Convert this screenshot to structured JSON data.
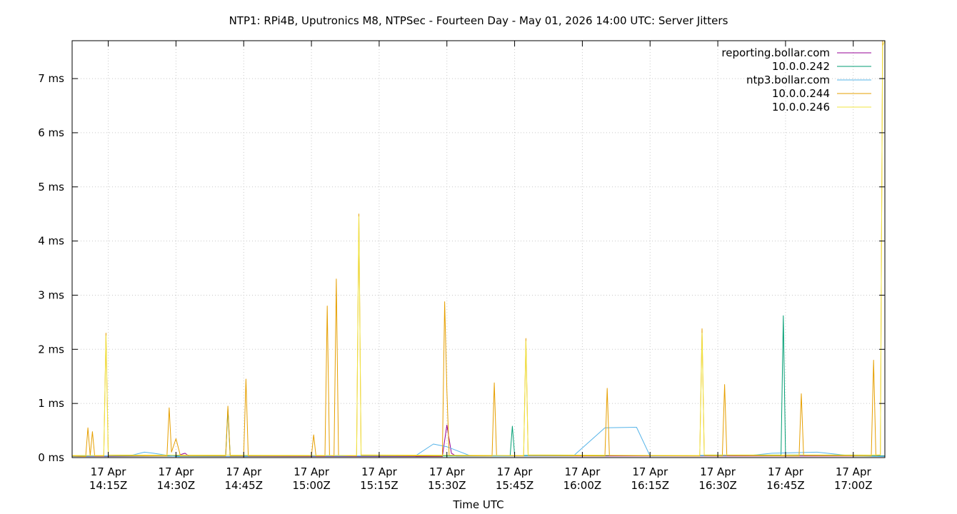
{
  "chart_data": {
    "type": "line",
    "title": "NTP1: RPi4B, Uputronics M8, NTPSec - Fourteen Day - May 01, 2026 14:00 UTC: Server Jitters",
    "xlabel": "Time UTC",
    "ylabel": "",
    "x_ticks": [
      {
        "value": "2026-04-17T14:15Z",
        "date": "17 Apr",
        "time": "14:15Z"
      },
      {
        "value": "2026-04-17T14:30Z",
        "date": "17 Apr",
        "time": "14:30Z"
      },
      {
        "value": "2026-04-17T14:45Z",
        "date": "17 Apr",
        "time": "14:45Z"
      },
      {
        "value": "2026-04-17T15:00Z",
        "date": "17 Apr",
        "time": "15:00Z"
      },
      {
        "value": "2026-04-17T15:15Z",
        "date": "17 Apr",
        "time": "15:15Z"
      },
      {
        "value": "2026-04-17T15:30Z",
        "date": "17 Apr",
        "time": "15:30Z"
      },
      {
        "value": "2026-04-17T15:45Z",
        "date": "17 Apr",
        "time": "15:45Z"
      },
      {
        "value": "2026-04-17T16:00Z",
        "date": "17 Apr",
        "time": "16:00Z"
      },
      {
        "value": "2026-04-17T16:15Z",
        "date": "17 Apr",
        "time": "16:15Z"
      },
      {
        "value": "2026-04-17T16:30Z",
        "date": "17 Apr",
        "time": "16:30Z"
      },
      {
        "value": "2026-04-17T16:45Z",
        "date": "17 Apr",
        "time": "16:45Z"
      },
      {
        "value": "2026-04-17T17:00Z",
        "date": "17 Apr",
        "time": "17:00Z"
      }
    ],
    "xlim": [
      "2026-04-17T14:07Z",
      "2026-04-17T17:07Z"
    ],
    "y_ticks": [
      {
        "value": 0,
        "label": "0 ms"
      },
      {
        "value": 1,
        "label": "1 ms"
      },
      {
        "value": 2,
        "label": "2 ms"
      },
      {
        "value": 3,
        "label": "3 ms"
      },
      {
        "value": 4,
        "label": "4 ms"
      },
      {
        "value": 5,
        "label": "5 ms"
      },
      {
        "value": 6,
        "label": "6 ms"
      },
      {
        "value": 7,
        "label": "7 ms"
      }
    ],
    "ylim": [
      0,
      7.7
    ],
    "grid": true,
    "legend_position": "top-right",
    "series": [
      {
        "name": "reporting.bollar.com",
        "color": "#940094",
        "points": [
          [
            "2026-04-17T14:07Z",
            0.02
          ],
          [
            "2026-04-17T14:30Z",
            0.03
          ],
          [
            "2026-04-17T14:32Z",
            0.08
          ],
          [
            "2026-04-17T14:33Z",
            0.02
          ],
          [
            "2026-04-17T15:29Z",
            0.02
          ],
          [
            "2026-04-17T15:30Z",
            0.6
          ],
          [
            "2026-04-17T15:31Z",
            0.08
          ],
          [
            "2026-04-17T15:32Z",
            0.03
          ],
          [
            "2026-04-17T16:45Z",
            0.03
          ],
          [
            "2026-04-17T17:07Z",
            0.03
          ]
        ]
      },
      {
        "name": "10.0.0.242",
        "color": "#009e73",
        "points": [
          [
            "2026-04-17T14:07Z",
            0.03
          ],
          [
            "2026-04-17T14:41Z",
            0.03
          ],
          [
            "2026-04-17T14:41:30Z",
            0.9
          ],
          [
            "2026-04-17T14:42Z",
            0.03
          ],
          [
            "2026-04-17T15:44Z",
            0.03
          ],
          [
            "2026-04-17T15:44:30Z",
            0.58
          ],
          [
            "2026-04-17T15:45Z",
            0.04
          ],
          [
            "2026-04-17T16:44Z",
            0.04
          ],
          [
            "2026-04-17T16:44:30Z",
            2.62
          ],
          [
            "2026-04-17T16:45Z",
            0.05
          ],
          [
            "2026-04-17T17:07Z",
            0.03
          ]
        ]
      },
      {
        "name": "ntp3.bollar.com",
        "color": "#56b4e9",
        "points": [
          [
            "2026-04-17T14:07Z",
            0.02
          ],
          [
            "2026-04-17T14:20Z",
            0.04
          ],
          [
            "2026-04-17T14:23Z",
            0.1
          ],
          [
            "2026-04-17T14:25Z",
            0.08
          ],
          [
            "2026-04-17T14:30Z",
            0.02
          ],
          [
            "2026-04-17T15:23Z",
            0.03
          ],
          [
            "2026-04-17T15:27Z",
            0.25
          ],
          [
            "2026-04-17T15:30Z",
            0.2
          ],
          [
            "2026-04-17T15:35Z",
            0.04
          ],
          [
            "2026-04-17T15:40Z",
            0.03
          ],
          [
            "2026-04-17T15:58Z",
            0.03
          ],
          [
            "2026-04-17T16:05Z",
            0.55
          ],
          [
            "2026-04-17T16:12Z",
            0.56
          ],
          [
            "2026-04-17T16:15Z",
            0.03
          ],
          [
            "2026-04-17T16:37Z",
            0.04
          ],
          [
            "2026-04-17T16:42Z",
            0.08
          ],
          [
            "2026-04-17T16:52Z",
            0.1
          ],
          [
            "2026-04-17T17:00Z",
            0.03
          ],
          [
            "2026-04-17T17:07Z",
            0.02
          ]
        ]
      },
      {
        "name": "10.0.0.244",
        "color": "#e69f00",
        "points": [
          [
            "2026-04-17T14:07Z",
            0.03
          ],
          [
            "2026-04-17T14:10Z",
            0.02
          ],
          [
            "2026-04-17T14:10:30Z",
            0.55
          ],
          [
            "2026-04-17T14:11Z",
            0.03
          ],
          [
            "2026-04-17T14:11:30Z",
            0.48
          ],
          [
            "2026-04-17T14:12Z",
            0.03
          ],
          [
            "2026-04-17T14:14Z",
            0.03
          ],
          [
            "2026-04-17T14:14:30Z",
            2.3
          ],
          [
            "2026-04-17T14:15Z",
            0.04
          ],
          [
            "2026-04-17T14:28Z",
            0.03
          ],
          [
            "2026-04-17T14:28:30Z",
            0.92
          ],
          [
            "2026-04-17T14:29Z",
            0.1
          ],
          [
            "2026-04-17T14:30Z",
            0.35
          ],
          [
            "2026-04-17T14:31Z",
            0.03
          ],
          [
            "2026-04-17T14:41Z",
            0.03
          ],
          [
            "2026-04-17T14:41:30Z",
            0.95
          ],
          [
            "2026-04-17T14:42Z",
            0.03
          ],
          [
            "2026-04-17T14:45Z",
            0.03
          ],
          [
            "2026-04-17T14:45:30Z",
            1.45
          ],
          [
            "2026-04-17T14:46Z",
            0.03
          ],
          [
            "2026-04-17T15:00Z",
            0.03
          ],
          [
            "2026-04-17T15:00:30Z",
            0.42
          ],
          [
            "2026-04-17T15:01Z",
            0.03
          ],
          [
            "2026-04-17T15:03Z",
            0.03
          ],
          [
            "2026-04-17T15:03:30Z",
            2.8
          ],
          [
            "2026-04-17T15:04Z",
            0.04
          ],
          [
            "2026-04-17T15:05Z",
            0.03
          ],
          [
            "2026-04-17T15:05:30Z",
            3.3
          ],
          [
            "2026-04-17T15:06Z",
            0.04
          ],
          [
            "2026-04-17T15:10Z",
            0.03
          ],
          [
            "2026-04-17T15:10:30Z",
            4.5
          ],
          [
            "2026-04-17T15:11Z",
            0.04
          ],
          [
            "2026-04-17T15:29Z",
            0.03
          ],
          [
            "2026-04-17T15:29:30Z",
            2.88
          ],
          [
            "2026-04-17T15:30Z",
            1.25
          ],
          [
            "2026-04-17T15:30:30Z",
            0.04
          ],
          [
            "2026-04-17T15:40Z",
            0.03
          ],
          [
            "2026-04-17T15:40:30Z",
            1.38
          ],
          [
            "2026-04-17T15:41Z",
            0.04
          ],
          [
            "2026-04-17T15:47Z",
            0.03
          ],
          [
            "2026-04-17T15:47:30Z",
            2.2
          ],
          [
            "2026-04-17T15:48Z",
            0.04
          ],
          [
            "2026-04-17T16:05Z",
            0.03
          ],
          [
            "2026-04-17T16:05:30Z",
            1.28
          ],
          [
            "2026-04-17T16:06Z",
            0.04
          ],
          [
            "2026-04-17T16:26Z",
            0.03
          ],
          [
            "2026-04-17T16:26:30Z",
            2.38
          ],
          [
            "2026-04-17T16:27Z",
            0.04
          ],
          [
            "2026-04-17T16:31Z",
            0.03
          ],
          [
            "2026-04-17T16:31:30Z",
            1.35
          ],
          [
            "2026-04-17T16:32Z",
            0.04
          ],
          [
            "2026-04-17T16:48Z",
            0.03
          ],
          [
            "2026-04-17T16:48:30Z",
            1.18
          ],
          [
            "2026-04-17T16:49Z",
            0.04
          ],
          [
            "2026-04-17T17:04Z",
            0.03
          ],
          [
            "2026-04-17T17:04:30Z",
            1.8
          ],
          [
            "2026-04-17T17:05Z",
            0.04
          ],
          [
            "2026-04-17T17:06Z",
            0.05
          ],
          [
            "2026-04-17T17:06:30Z",
            7.7
          ],
          [
            "2026-04-17T17:07Z",
            7.7
          ]
        ]
      },
      {
        "name": "10.0.0.246",
        "color": "#f0e442",
        "points": [
          [
            "2026-04-17T14:07Z",
            0.04
          ],
          [
            "2026-04-17T14:14Z",
            0.04
          ],
          [
            "2026-04-17T14:14:30Z",
            2.25
          ],
          [
            "2026-04-17T14:15Z",
            0.05
          ],
          [
            "2026-04-17T15:10Z",
            0.04
          ],
          [
            "2026-04-17T15:10:30Z",
            4.45
          ],
          [
            "2026-04-17T15:11Z",
            0.05
          ],
          [
            "2026-04-17T15:47Z",
            0.04
          ],
          [
            "2026-04-17T15:47:30Z",
            2.15
          ],
          [
            "2026-04-17T15:48Z",
            0.05
          ],
          [
            "2026-04-17T16:26Z",
            0.04
          ],
          [
            "2026-04-17T16:26:30Z",
            2.3
          ],
          [
            "2026-04-17T16:27Z",
            0.05
          ],
          [
            "2026-04-17T17:06Z",
            0.05
          ],
          [
            "2026-04-17T17:06:30Z",
            7.6
          ],
          [
            "2026-04-17T17:07Z",
            7.7
          ]
        ]
      }
    ]
  }
}
